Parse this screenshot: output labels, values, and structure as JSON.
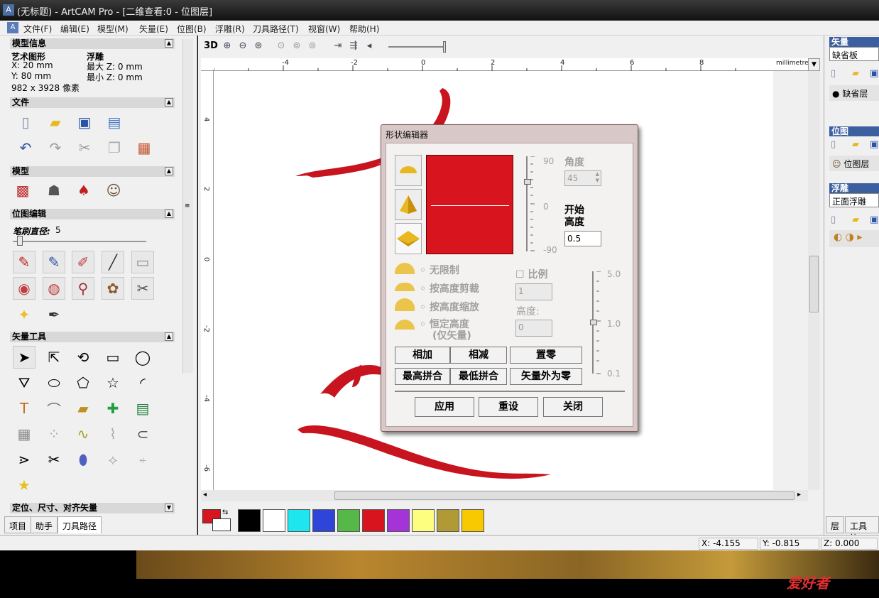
{
  "window": {
    "title": "(无标题) - ArtCAM Pro - [二维查看:0 - 位图层]"
  },
  "menu": [
    "文件(F)",
    "编辑(E)",
    "模型(M)",
    "矢量(E)",
    "位图(B)",
    "浮雕(R)",
    "刀具路径(T)",
    "视窗(W)",
    "帮助(H)"
  ],
  "left_panel": {
    "model_info": {
      "header": "模型信息",
      "col1_title": "艺术图形",
      "x": "X: 20 mm",
      "y": "Y: 80 mm",
      "pixels": "982 x 3928 像素",
      "col2_title": "浮雕",
      "max_z": "最大  Z: 0 mm",
      "min_z": "最小  Z: 0 mm"
    },
    "file_header": "文件",
    "model_header": "模型",
    "bitmap_edit_header": "位图编辑",
    "brush_label": "笔刷直径:",
    "brush_value": "5",
    "vector_tools_header": "矢量工具",
    "align_header": "定位、尺寸、对齐矢量",
    "tabs": [
      "项目",
      "助手",
      "刀具路径"
    ]
  },
  "toolbar": {
    "view_3d": "3D"
  },
  "rulers": {
    "units": "millimetres",
    "top_ticks": [
      "-4",
      "-2",
      "0",
      "2",
      "4",
      "6",
      "8"
    ],
    "left_ticks": [
      "4",
      "2",
      "0",
      "-2",
      "-4",
      "-6"
    ]
  },
  "palette": {
    "primary": "#d8141e",
    "colors": [
      "#000000",
      "#ffffff",
      "#1ee6ee",
      "#2f44d8",
      "#57b84a",
      "#d8141e",
      "#a434d8",
      "#fdfd80",
      "#b09a36",
      "#f8c800"
    ]
  },
  "dialog": {
    "title": "形状编辑器",
    "slider_top": "90",
    "slider_mid": "0",
    "slider_bottom": "-90",
    "angle_label": "角度",
    "angle_value": "45",
    "start_height_label1": "开始",
    "start_height_label2": "高度",
    "start_height_value": "0.5",
    "options": [
      "无限制",
      "按高度剪裁",
      "按高度缩放",
      "恒定高度",
      "(仅矢量)"
    ],
    "scale_label": "比例",
    "scale_value": "1",
    "height_label": "高度:",
    "height_value": "0",
    "right_slider": [
      "5.0",
      "1.0",
      "0.1"
    ],
    "btn_add": "相加",
    "btn_subtract": "相减",
    "btn_zero": "置零",
    "btn_max": "最高拼合",
    "btn_min": "最低拼合",
    "btn_zero_outside": "矢量外为零",
    "btn_apply": "应用",
    "btn_reset": "重设",
    "btn_close": "关闭",
    "preview_color": "#d8141e"
  },
  "right_panel": {
    "vector_header": "矢量",
    "vector_layer": "缺省板",
    "default_layer": "缺省层",
    "bitmap_header": "位图",
    "bitmap_layer": "位图层",
    "relief_header": "浮雕",
    "relief_layer": "正面浮雕",
    "tabs": [
      "层",
      "工具箱"
    ]
  },
  "status": {
    "x": "X: -4.155",
    "y": "Y: -0.815",
    "z": "Z: 0.000"
  },
  "banner": {
    "logo": "爱好者"
  }
}
